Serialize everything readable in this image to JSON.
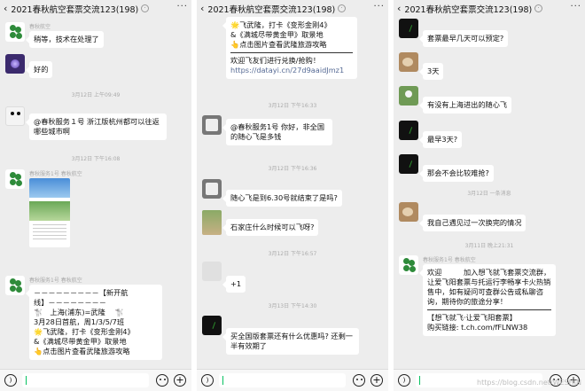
{
  "chat_title": "2021春秋航空套票交流123(198)",
  "input": {
    "placeholder": ""
  },
  "watermark": "https://blog.csdn.net/WESHIN",
  "pane1": {
    "m1": {
      "nick": "春秋航空",
      "text": "稍等，技术在处理了"
    },
    "m2": {
      "text": "好的"
    },
    "ts1": "3月12日 上午09:49",
    "m3": {
      "text": "@春秋服务１号  浙江版杭州都可以往返哪些城市啊"
    },
    "ts2": "3月12日 下午16:08",
    "m4": {
      "nick": "春秋服务1号  春秋航空"
    },
    "m5": {
      "nick": "春秋服务1号  春秋航空",
      "l1": "－－－－－－－－－【新开航",
      "l2": "线】－－－－－－－－",
      "l3": "🐩　上海(浦东)=武隆　 🐩",
      "l4": "3月28日首航，周1/3/5/7班",
      "l5": "🌟飞武隆，打卡《变形金刚4》",
      "l6": "&《满城尽带黄金甲》取景地",
      "l7": "👆点击图片查看武隆旅游攻略"
    }
  },
  "pane2": {
    "m1": {
      "l1": "🌟飞武隆，打卡《变形金刚4》",
      "l2": "&《满城尽带黄金甲》取景地",
      "l3": "👆点击图片查看武隆旅游攻略",
      "l4": "欢迎飞友们进行兑换/抢购！",
      "link": "https://datayi.cn/27d9aaidJmz1"
    },
    "ts1": "3月12日 下午16:33",
    "m2": {
      "text": "@春秋服务1号  你好，非全国的随心飞是多钱"
    },
    "ts2": "3月12日 下午16:36",
    "m3": {
      "text": "随心飞是到6.30号就结束了是吗?"
    },
    "m4": {
      "text": "石家庄什么时候可以飞呀?"
    },
    "ts3": "3月12日 下午16:57",
    "m5": {
      "text": "+1"
    },
    "ts4": "3月13日 下午14:30",
    "m6": {
      "text": "买全国版套票还有什么优惠吗? 还剩一半有效期了"
    }
  },
  "pane3": {
    "m1": {
      "text": "套票最早几天可以预定?"
    },
    "m2": {
      "text": "3天"
    },
    "m3": {
      "text": "有没有上海进出的随心飞"
    },
    "m4": {
      "text": "最早3天?"
    },
    "m5": {
      "text": "那会不会比较难抢?"
    },
    "sys": "3月12日 一条消息",
    "m6": {
      "text": "我自己遇见过一次换完的情况"
    },
    "ts1": "3月11日 晚上21:31",
    "m7": {
      "nick": "春秋服务1号  春秋航空",
      "l1": "欢迎　　　加入想飞就飞套票交流群，让爱飞阳套票与托运行李畅享卡火热销售中，如有疑问可查群公告或私聊咨询，期待你的旅途分享！",
      "l2": "【想飞就飞·让爱飞阳套票】",
      "l3": "购买链接: t.ch.com/fFLNW38"
    }
  }
}
